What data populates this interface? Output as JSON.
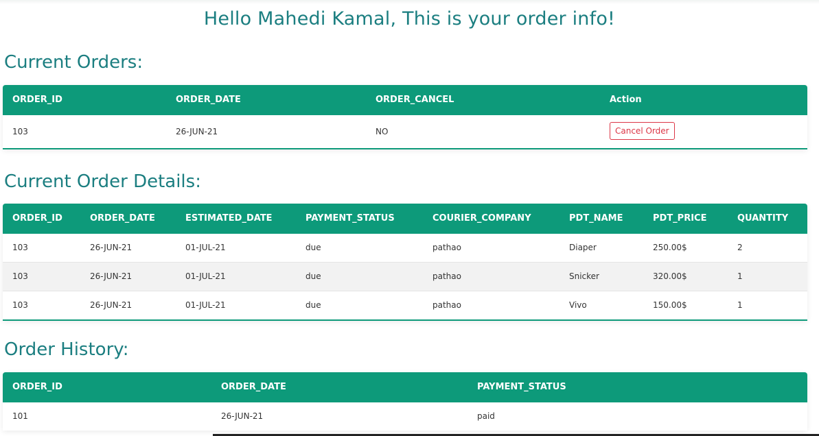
{
  "greeting": "Hello Mahedi Kamal, This is your order info!",
  "colors": {
    "header_bg": "#0d9a7a",
    "title": "#1b7e80",
    "cancel_accent": "#dc3545"
  },
  "current_orders": {
    "title": "Current Orders:",
    "headers": [
      "ORDER_ID",
      "ORDER_DATE",
      "ORDER_CANCEL",
      "Action"
    ],
    "rows": [
      {
        "order_id": "103",
        "order_date": "26-JUN-21",
        "order_cancel": "NO",
        "action_label": "Cancel Order"
      }
    ]
  },
  "current_order_details": {
    "title": "Current Order Details:",
    "headers": [
      "ORDER_ID",
      "ORDER_DATE",
      "ESTIMATED_DATE",
      "PAYMENT_STATUS",
      "COURIER_COMPANY",
      "PDT_NAME",
      "PDT_PRICE",
      "QUANTITY"
    ],
    "rows": [
      [
        "103",
        "26-JUN-21",
        "01-JUL-21",
        "due",
        "pathao",
        "Diaper",
        "250.00$",
        "2"
      ],
      [
        "103",
        "26-JUN-21",
        "01-JUL-21",
        "due",
        "pathao",
        "Snicker",
        "320.00$",
        "1"
      ],
      [
        "103",
        "26-JUN-21",
        "01-JUL-21",
        "due",
        "pathao",
        "Vivo",
        "150.00$",
        "1"
      ]
    ]
  },
  "order_history": {
    "title": "Order History:",
    "headers": [
      "ORDER_ID",
      "ORDER_DATE",
      "PAYMENT_STATUS"
    ],
    "rows": [
      [
        "101",
        "26-JUN-21",
        "paid"
      ]
    ]
  }
}
